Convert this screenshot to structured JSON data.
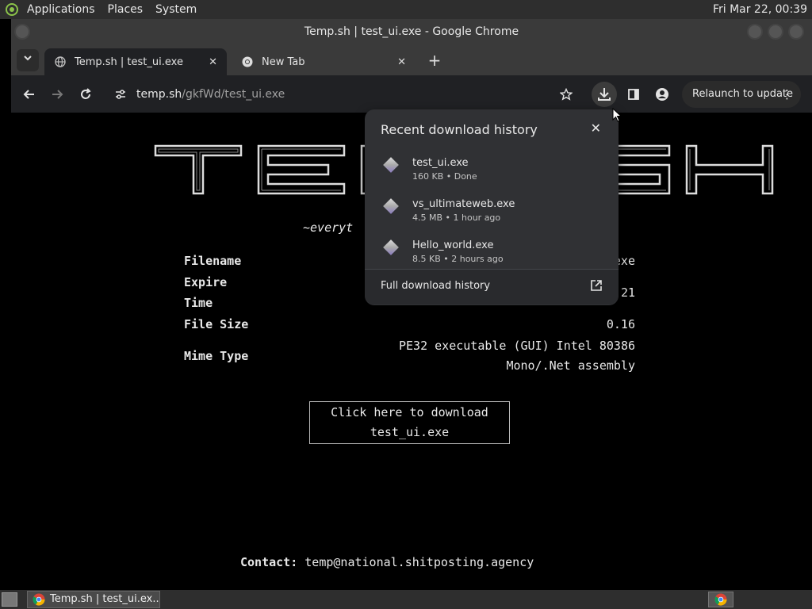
{
  "top_panel": {
    "menus": [
      "Applications",
      "Places",
      "System"
    ],
    "clock": "Fri Mar 22, 00:39"
  },
  "window": {
    "title": "Temp.sh | test_ui.exe - Google Chrome"
  },
  "tabs": [
    {
      "label": "Temp.sh | test_ui.exe",
      "icon": "globe-icon",
      "active": true
    },
    {
      "label": "New Tab",
      "icon": "chrome-icon",
      "active": false
    }
  ],
  "toolbar": {
    "url_host": "temp.sh",
    "url_path": "/gkfWd/test_ui.exe",
    "relaunch_label": "Relaunch to update"
  },
  "page": {
    "logo_text": "TEMP.SH",
    "tagline": "~everyt",
    "fields": [
      {
        "key": "Filename",
        "value": "exe"
      },
      {
        "key": "Expire",
        "value": ""
      },
      {
        "key": "Time",
        "value": "21"
      },
      {
        "key": "File Size",
        "value": "0.16"
      },
      {
        "key": "Mime Type",
        "value": "PE32 executable (GUI) Intel 80386"
      }
    ],
    "mime_line2": "Mono/.Net assembly",
    "download_line1": "Click here to download",
    "download_line2": "test_ui.exe",
    "contact_label": "Contact:",
    "contact_email": "temp@national.shitposting.agency"
  },
  "download_bubble": {
    "title": "Recent download history",
    "items": [
      {
        "name": "test_ui.exe",
        "meta": "160 KB • Done"
      },
      {
        "name": "vs_ultimateweb.exe",
        "meta": "4.5 MB • 1 hour ago"
      },
      {
        "name": "Hello_world.exe",
        "meta": "8.5 KB • 2 hours ago"
      }
    ],
    "footer_label": "Full download history"
  },
  "taskbar": {
    "window_label": "Temp.sh | test_ui.ex..."
  }
}
